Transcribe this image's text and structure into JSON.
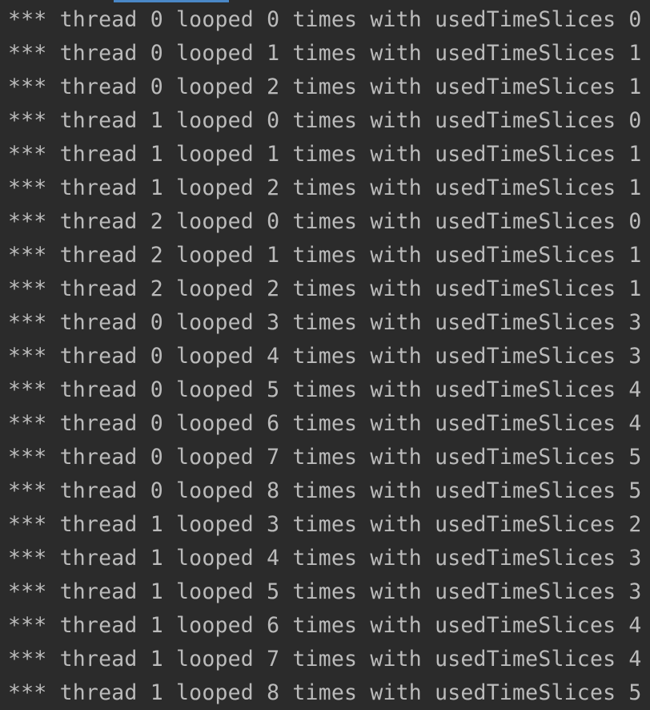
{
  "console": {
    "lines": [
      "*** thread 0 looped 0 times with usedTimeSlices 0",
      "*** thread 0 looped 1 times with usedTimeSlices 1",
      "*** thread 0 looped 2 times with usedTimeSlices 1",
      "*** thread 1 looped 0 times with usedTimeSlices 0",
      "*** thread 1 looped 1 times with usedTimeSlices 1",
      "*** thread 1 looped 2 times with usedTimeSlices 1",
      "*** thread 2 looped 0 times with usedTimeSlices 0",
      "*** thread 2 looped 1 times with usedTimeSlices 1",
      "*** thread 2 looped 2 times with usedTimeSlices 1",
      "*** thread 0 looped 3 times with usedTimeSlices 3",
      "*** thread 0 looped 4 times with usedTimeSlices 3",
      "*** thread 0 looped 5 times with usedTimeSlices 4",
      "*** thread 0 looped 6 times with usedTimeSlices 4",
      "*** thread 0 looped 7 times with usedTimeSlices 5",
      "*** thread 0 looped 8 times with usedTimeSlices 5",
      "*** thread 1 looped 3 times with usedTimeSlices 2",
      "*** thread 1 looped 4 times with usedTimeSlices 3",
      "*** thread 1 looped 5 times with usedTimeSlices 3",
      "*** thread 1 looped 6 times with usedTimeSlices 4",
      "*** thread 1 looped 7 times with usedTimeSlices 4",
      "*** thread 1 looped 8 times with usedTimeSlices 5"
    ]
  },
  "colors": {
    "background": "#2b2b2b",
    "text": "#bbbbbb",
    "tab_indicator": "#4a88c7"
  }
}
